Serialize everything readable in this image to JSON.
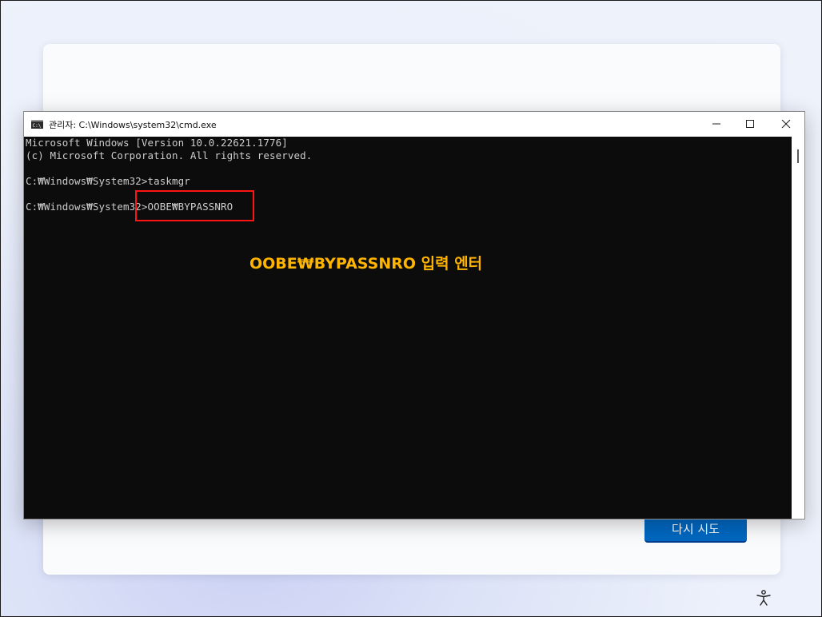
{
  "oobe": {
    "retry_label": "다시 시도"
  },
  "cmd": {
    "title": "관리자: C:\\Windows\\system32\\cmd.exe",
    "lines": [
      "Microsoft Windows [Version 10.0.22621.1776]",
      "(c) Microsoft Corporation. All rights reserved.",
      "",
      "C:₩Windows₩System32>taskmgr",
      "",
      "C:₩Windows₩System32>OOBE₩BYPASSNRO"
    ],
    "annotation": "OOBE₩BYPASSNRO 입력 엔터"
  },
  "icons": {
    "app": "cmd-icon",
    "minimize": "minimize-icon",
    "maximize": "maximize-icon",
    "close": "close-icon",
    "accessibility": "accessibility-icon"
  },
  "colors": {
    "console_bg": "#0c0c0c",
    "console_text": "#cccccc",
    "annotation": "#ffb400",
    "highlight": "#ff1414",
    "accent": "#0067c0"
  }
}
